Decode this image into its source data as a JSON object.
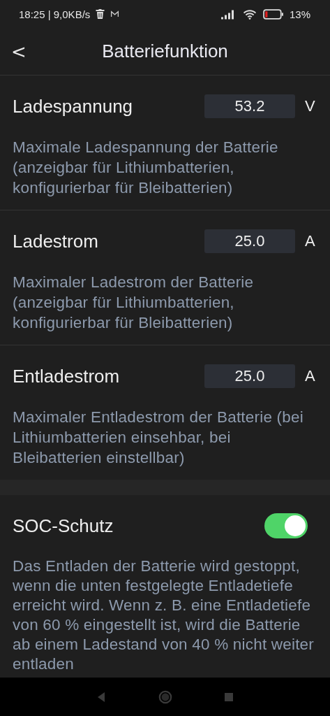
{
  "status_bar": {
    "time": "18:25 | 9,0KB/s",
    "battery": "13%"
  },
  "header": {
    "back": "<",
    "title": "Batteriefunktion"
  },
  "settings": [
    {
      "kind": "input",
      "label": "Ladespannung",
      "value": "53.2",
      "unit": "V",
      "description": "Maximale Ladespannung der Batterie (anzeigbar für Lithiumbatterien, konfigurierbar für Bleibatterien)"
    },
    {
      "kind": "input",
      "label": "Ladestrom",
      "value": "25.0",
      "unit": "A",
      "description": "Maximaler Ladestrom der Batterie (anzeigbar für Lithiumbatterien, konfigurierbar für Bleibatterien)"
    },
    {
      "kind": "input",
      "label": "Entladestrom",
      "value": "25.0",
      "unit": "A",
      "description": "Maximaler Entladestrom der Batterie (bei Lithiumbatterien einsehbar, bei Bleibatterien einstellbar)"
    },
    {
      "kind": "toggle",
      "label": "SOC-Schutz",
      "on": true,
      "description": "Das Entladen der Batterie wird gestoppt, wenn die unten festgelegte Entladetiefe erreicht wird. Wenn z. B. eine Entladetiefe von 60 % eingestellt ist, wird die Batterie ab einem Ladestand von 40 % nicht weiter entladen"
    }
  ]
}
